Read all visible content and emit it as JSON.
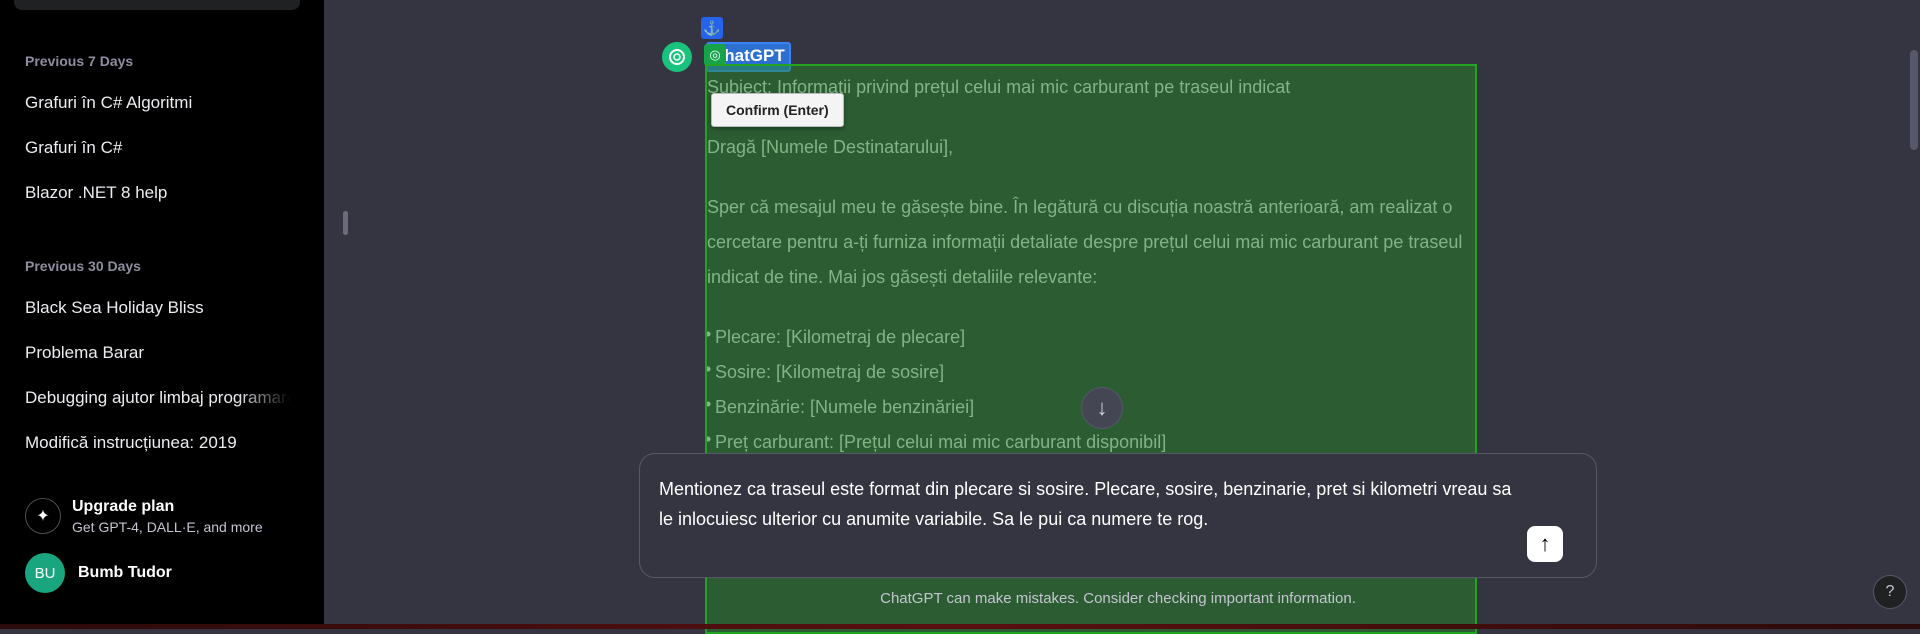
{
  "sidebar": {
    "sections": [
      {
        "label": "Previous 7 Days",
        "items": [
          "Grafuri în C# Algoritmi",
          "Grafuri în C#",
          "Blazor .NET 8 help"
        ]
      },
      {
        "label": "Previous 30 Days",
        "items": [
          "Black Sea Holiday Bliss",
          "Problema Barar",
          "Debugging ajutor limbaj programare",
          "Modifică instrucțiunea: 2019"
        ]
      }
    ],
    "upgrade": {
      "title": "Upgrade plan",
      "subtitle": "Get GPT-4, DALL·E, and more",
      "icon": "sparkle-icon"
    },
    "user": {
      "initials": "BU",
      "name": "Bumb Tudor",
      "avatar_color": "#19a67e"
    }
  },
  "chat": {
    "assistant_name": "ChatGPT",
    "tooltip": "Confirm (Enter)",
    "message": {
      "subject": "Subiect: Informații privind prețul celui mai mic carburant pe traseul indicat",
      "greeting": "Dragă [Numele Destinatarului],",
      "paragraph": "Sper că mesajul meu te găsește bine. În legătură cu discuția noastră anterioară, am realizat o cercetare pentru a-ți furniza informații detaliate despre prețul celui mai mic carburant pe traseul indicat de tine. Mai jos găsești detaliile relevante:",
      "bullets": [
        "Plecare: [Kilometraj de plecare]",
        "Sosire: [Kilometraj de sosire]",
        "Benzinărie: [Numele benzinăriei]",
        "Preț carburant: [Prețul celui mai mic carburant disponibil]"
      ]
    },
    "composer": {
      "text": "Mentionez ca traseul este format din plecare si sosire. Plecare, sosire, benzinarie, pret si kilometri vreau sa le inlocuiesc ulterior cu anumite variabile. Sa le pui ca numere te rog."
    },
    "disclaimer": "ChatGPT can make mistakes. Consider checking important information.",
    "help": "?"
  },
  "colors": {
    "sidebar_bg": "#000000",
    "main_bg": "#343541",
    "accent_green": "#19c37d"
  }
}
